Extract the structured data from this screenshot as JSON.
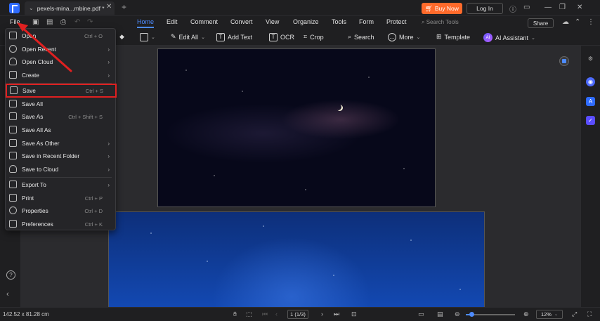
{
  "titlebar": {
    "tab_title": "pexels-mina...mbine.pdf *",
    "buy_now": "Buy Now",
    "login": "Log In"
  },
  "menu": {
    "file": "File",
    "items": [
      "Home",
      "Edit",
      "Comment",
      "Convert",
      "View",
      "Organize",
      "Tools",
      "Form",
      "Protect"
    ],
    "search_placeholder": "Search Tools",
    "share": "Share"
  },
  "toolbar": {
    "edit_all": "Edit All",
    "add_text": "Add Text",
    "ocr": "OCR",
    "crop": "Crop",
    "search": "Search",
    "more": "More",
    "template": "Template",
    "ai_assistant": "AI Assistant",
    "ai_badge": "AI"
  },
  "file_menu": {
    "items": [
      {
        "label": "Open",
        "shortcut": "Ctrl + O",
        "submenu": false
      },
      {
        "label": "Open Recent",
        "shortcut": "",
        "submenu": true
      },
      {
        "label": "Open Cloud",
        "shortcut": "",
        "submenu": true
      },
      {
        "label": "Create",
        "shortcut": "",
        "submenu": true
      },
      {
        "label": "Save",
        "shortcut": "Ctrl + S",
        "submenu": false
      },
      {
        "label": "Save All",
        "shortcut": "",
        "submenu": false
      },
      {
        "label": "Save As",
        "shortcut": "Ctrl + Shift + S",
        "submenu": false
      },
      {
        "label": "Save All As",
        "shortcut": "",
        "submenu": false
      },
      {
        "label": "Save As Other",
        "shortcut": "",
        "submenu": true
      },
      {
        "label": "Save in Recent Folder",
        "shortcut": "",
        "submenu": true
      },
      {
        "label": "Save to Cloud",
        "shortcut": "",
        "submenu": true
      },
      {
        "label": "Export To",
        "shortcut": "",
        "submenu": true
      },
      {
        "label": "Print",
        "shortcut": "Ctrl + P",
        "submenu": false
      },
      {
        "label": "Properties",
        "shortcut": "Ctrl + D",
        "submenu": false
      },
      {
        "label": "Preferences",
        "shortcut": "Ctrl + K",
        "submenu": false
      }
    ]
  },
  "statusbar": {
    "dimensions": "142.52 x 81.28 cm",
    "page_indicator": "1 (1/3)",
    "zoom": "12%",
    "zoom_fraction": 0.12
  },
  "colors": {
    "accent": "#4d8bff",
    "buy_now": "#ff6a2b",
    "annotation": "#e02020"
  }
}
